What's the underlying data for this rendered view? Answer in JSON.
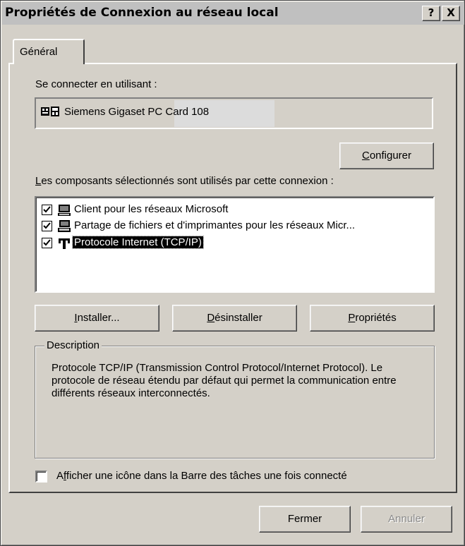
{
  "window": {
    "title": "Propriétés de Connexion au réseau local",
    "help_button": "?",
    "close_button": "X"
  },
  "tabs": [
    {
      "label": "Général",
      "selected": true
    }
  ],
  "connect_using": {
    "label": "Se connecter en utilisant :",
    "device_name_part1": "Siemens Gigaset",
    "device_name_part2": "PC Card 108",
    "device_icon": "network-adapter-icon"
  },
  "configure_button": {
    "label_prefix": "",
    "label_mnemonic": "C",
    "label_suffix": "onfigurer"
  },
  "components": {
    "label_mnemonic": "L",
    "label_suffix": "es composants sélectionnés sont utilisés par cette connexion :",
    "items": [
      {
        "label": "Client pour les réseaux Microsoft",
        "checked": true,
        "icon": "network-client-icon",
        "selected": false
      },
      {
        "label": "Partage de fichiers et d'imprimantes pour les réseaux Micr...",
        "checked": true,
        "icon": "file-printer-sharing-icon",
        "selected": false
      },
      {
        "label": "Protocole Internet (TCP/IP)",
        "checked": true,
        "icon": "protocol-icon",
        "selected": true
      }
    ]
  },
  "action_buttons": {
    "install": {
      "label_mnemonic": "I",
      "label_suffix": "nstaller..."
    },
    "uninstall": {
      "label_mnemonic": "D",
      "label_suffix": "ésinstaller"
    },
    "properties": {
      "label_mnemonic": "P",
      "label_suffix": "ropriétés"
    }
  },
  "description": {
    "title": "Description",
    "text": "Protocole TCP/IP (Transmission Control Protocol/Internet Protocol). Le protocole de réseau étendu par défaut qui permet la communication entre différents réseaux interconnectés."
  },
  "show_icon_checkbox": {
    "prefix": "A",
    "mnemonic": "f",
    "suffix": "ficher une icône dans la Barre des tâches une fois connecté",
    "checked": false
  },
  "footer": {
    "close_label": "Fermer",
    "cancel_label": "Annuler",
    "cancel_disabled": true
  }
}
